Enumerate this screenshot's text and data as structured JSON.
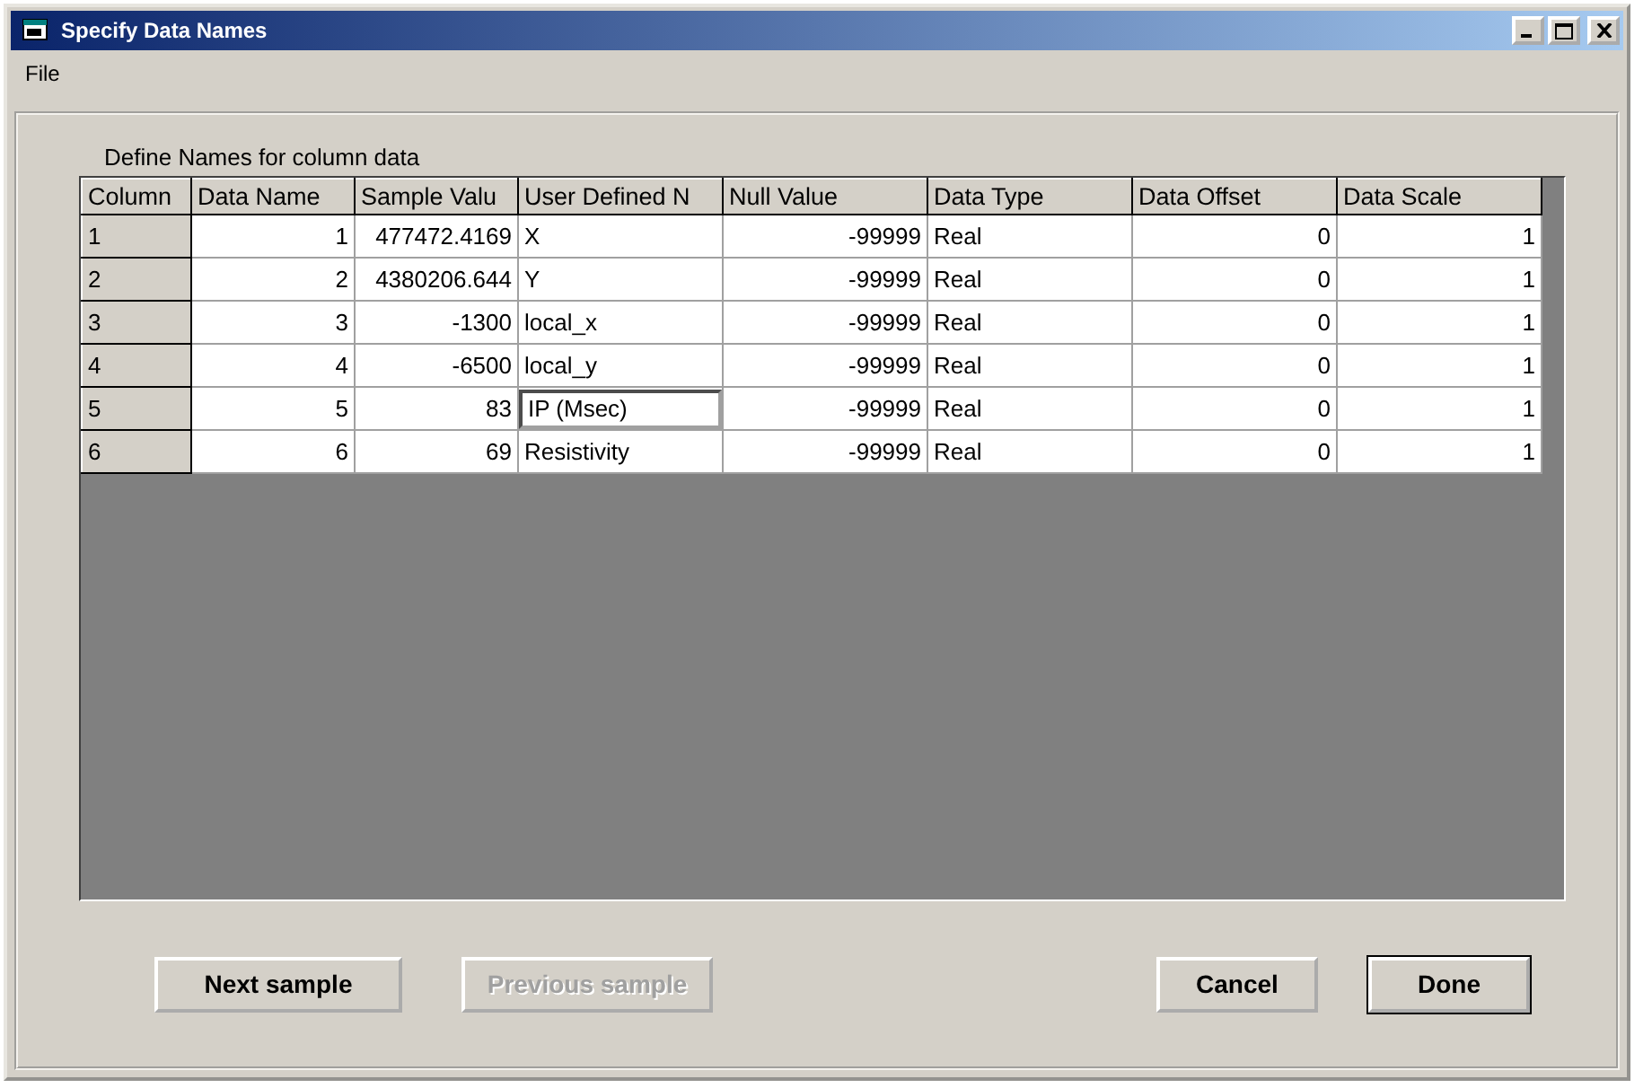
{
  "window": {
    "title": "Specify Data Names"
  },
  "menu": [
    "File"
  ],
  "grid": {
    "caption": "Define Names for column data",
    "columns": [
      "Column",
      "Data Name",
      "Sample Valu",
      "User Defined N",
      "Null Value",
      "Data Type",
      "Data Offset",
      "Data Scale"
    ],
    "rows": [
      {
        "cells": [
          "1",
          "1",
          "477472.4169",
          "X",
          "-99999",
          "Real",
          "0",
          "1"
        ],
        "editing": false
      },
      {
        "cells": [
          "2",
          "2",
          "4380206.644",
          "Y",
          "-99999",
          "Real",
          "0",
          "1"
        ],
        "editing": false
      },
      {
        "cells": [
          "3",
          "3",
          "-1300",
          "local_x",
          "-99999",
          "Real",
          "0",
          "1"
        ],
        "editing": false
      },
      {
        "cells": [
          "4",
          "4",
          "-6500",
          "local_y",
          "-99999",
          "Real",
          "0",
          "1"
        ],
        "editing": false
      },
      {
        "cells": [
          "5",
          "5",
          "83",
          "IP (Msec)",
          "-99999",
          "Real",
          "0",
          "1"
        ],
        "editing": true
      },
      {
        "cells": [
          "6",
          "6",
          "69",
          "Resistivity",
          "-99999",
          "Real",
          "0",
          "1"
        ],
        "editing": false
      }
    ]
  },
  "buttons": [
    {
      "label": "Next sample",
      "disabled": false,
      "default": false
    },
    {
      "label": "Previous sample",
      "disabled": true,
      "default": false
    },
    {
      "label": "Cancel",
      "disabled": false,
      "default": false
    },
    {
      "label": "Done",
      "disabled": false,
      "default": true
    }
  ]
}
